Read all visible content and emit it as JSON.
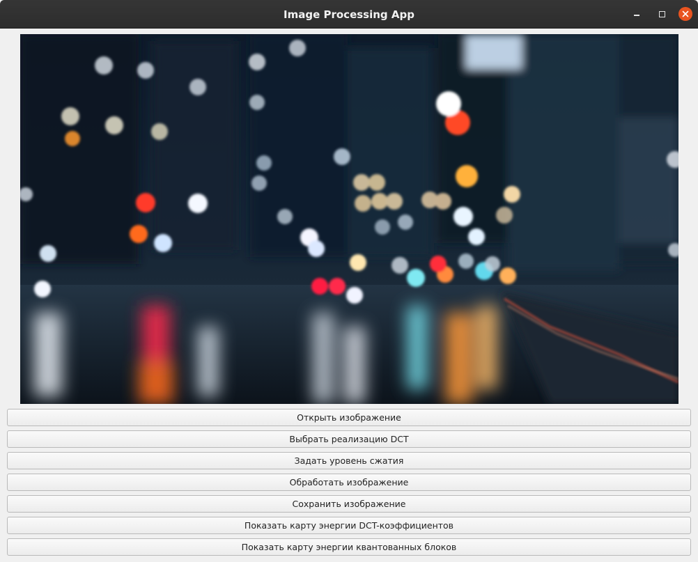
{
  "window": {
    "title": "Image Processing App"
  },
  "image_view": {
    "icon": "photo-preview",
    "description_visible": false
  },
  "buttons": [
    {
      "label": "Открыть изображение"
    },
    {
      "label": "Выбрать реализацию DCT"
    },
    {
      "label": "Задать уровень сжатия"
    },
    {
      "label": "Обработать изображение"
    },
    {
      "label": "Сохранить изображение"
    },
    {
      "label": "Показать карту энергии DCT-коэффициентов"
    },
    {
      "label": "Показать карту энергии квантованных блоков"
    }
  ],
  "colors": {
    "titlebar": "#2d2d2d",
    "close_accent": "#e95420",
    "window_bg": "#f0f0f0"
  }
}
